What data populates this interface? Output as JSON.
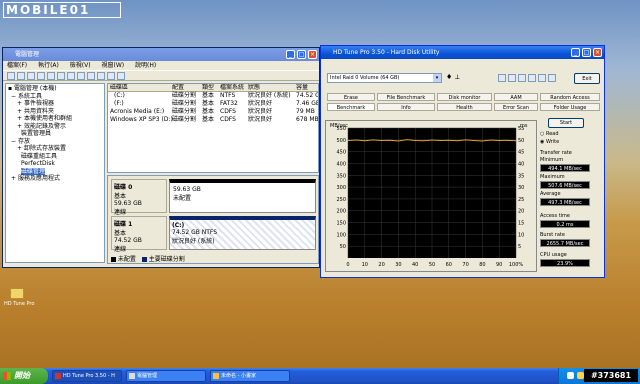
{
  "watermark_logo": "MOBILE01",
  "watermark_id": "#373681",
  "desktop": {
    "icon_label": "HD Tune Pro"
  },
  "disk_mgmt": {
    "title": "電腦管理",
    "menu": [
      "檔案(F)",
      "執行(A)",
      "檢視(V)",
      "視窗(W)",
      "說明(H)"
    ],
    "tree": [
      {
        "label": "電腦管理 (本機)",
        "level": 0
      },
      {
        "label": "系統工具",
        "level": 1
      },
      {
        "label": "事件檢視器",
        "level": 2
      },
      {
        "label": "共用資料夾",
        "level": 2
      },
      {
        "label": "本機使用者和群組",
        "level": 2
      },
      {
        "label": "效能記錄及警示",
        "level": 2
      },
      {
        "label": "裝置管理員",
        "level": 2
      },
      {
        "label": "存放",
        "level": 1
      },
      {
        "label": "卸除式存放裝置",
        "level": 2
      },
      {
        "label": "磁碟重組工具",
        "level": 2
      },
      {
        "label": "PerfectDisk",
        "level": 2
      },
      {
        "label": "磁碟管理",
        "level": 2
      },
      {
        "label": "服務及應用程式",
        "level": 1
      }
    ],
    "columns": [
      "磁碟區",
      "配置",
      "類型",
      "檔案系統",
      "狀態",
      "容量"
    ],
    "rows": [
      [
        "(C:)",
        "磁碟分割",
        "基本",
        "NTFS",
        "狀況良好 (系統)",
        "74.52 GB"
      ],
      [
        "(F:)",
        "磁碟分割",
        "基本",
        "FAT32",
        "狀況良好",
        "7.46 GB"
      ],
      [
        "Acronis Media (E:)",
        "磁碟分割",
        "基本",
        "CDFS",
        "狀況良好",
        "79 MB"
      ],
      [
        "Windows XP SP3 (D:)",
        "磁碟分割",
        "基本",
        "CDFS",
        "狀況良好",
        "678 MB"
      ]
    ],
    "disk0": {
      "name": "磁碟 0",
      "type": "基本",
      "size": "59.63 GB",
      "status": "連線",
      "part_size": "59.63 GB",
      "part_status": "未配置"
    },
    "disk1": {
      "name": "磁碟 1",
      "type": "基本",
      "size": "74.52 GB",
      "status": "連線",
      "part_name": "(C:)",
      "part_size": "74.52 GB NTFS",
      "part_status": "狀況良好 (系統)"
    },
    "legend": [
      "未配置",
      "主要磁碟分割"
    ]
  },
  "hdtune": {
    "title": "HD Tune Pro 3.50 - Hard Disk Utility",
    "drive": "Intel  Raid 0 Volume (64 GB)",
    "exit": "Exit",
    "tabs_row1": [
      "Erase",
      "File Benchmark",
      "Disk monitor",
      "AAM",
      "Random Access"
    ],
    "tabs_row2": [
      "Benchmark",
      "Info",
      "Health",
      "Error Scan",
      "Folder Usage"
    ],
    "selected_tab": "Benchmark",
    "start": "Start",
    "read": "Read",
    "write": "Write",
    "transfer_rate": "Transfer rate",
    "minimum_label": "Minimum",
    "minimum": "494.1 MB/sec",
    "maximum_label": "Maximum",
    "maximum": "507.6 MB/sec",
    "average_label": "Average",
    "average": "497.3 MB/sec",
    "access_label": "Access time",
    "access": "0.2 ms",
    "burst_label": "Burst rate",
    "burst": "2655.7 MB/sec",
    "cpu_label": "CPU usage",
    "cpu": "23.9%"
  },
  "chart_data": {
    "type": "line",
    "ylabel": "MB/sec",
    "y2label": "ms",
    "ylim": [
      0,
      550
    ],
    "y2lim": [
      0,
      55
    ],
    "yticks": [
      550,
      500,
      450,
      400,
      350,
      300,
      250,
      200,
      150,
      100,
      50
    ],
    "y2ticks": [
      55,
      50,
      45,
      40,
      35,
      30,
      25,
      20,
      15,
      10,
      5
    ],
    "xticks": [
      "0",
      "10",
      "20",
      "30",
      "40",
      "50",
      "60",
      "70",
      "80",
      "90",
      "100%"
    ],
    "series": [
      {
        "color": "#e6a13a",
        "x": [
          0,
          5,
          10,
          15,
          20,
          25,
          30,
          35,
          40,
          45,
          50,
          55,
          60,
          65,
          70,
          75,
          80,
          85,
          90,
          95,
          100
        ],
        "values": [
          497,
          499,
          496,
          500,
          497,
          498,
          495,
          501,
          497,
          496,
          499,
          497,
          498,
          496,
          500,
          497,
          495,
          499,
          497,
          498,
          496
        ]
      }
    ]
  },
  "taskbar": {
    "start": "開始",
    "tasks": [
      "HD Tune Pro 3.50 - H",
      "電腦管理",
      "未命名 - 小畫家"
    ]
  }
}
